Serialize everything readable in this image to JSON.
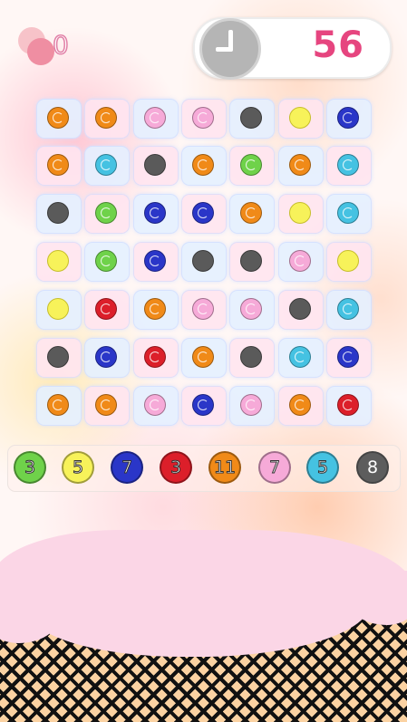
{
  "score": {
    "value": "0"
  },
  "timer": {
    "value": "56",
    "icon": "clock-icon"
  },
  "colors": {
    "orange": "#f08a18",
    "pink": "#f6aad8",
    "black": "#5a5a5a",
    "yellow": "#f7f25a",
    "blue": "#2a36c8",
    "cyan": "#45c2e2",
    "green": "#6fd24a",
    "red": "#dc1f2a"
  },
  "board": [
    [
      "orange",
      "orange",
      "pink",
      "pink",
      "black",
      "yellow",
      "blue"
    ],
    [
      "orange",
      "cyan",
      "black",
      "orange",
      "green",
      "orange",
      "cyan"
    ],
    [
      "black",
      "green",
      "blue",
      "blue",
      "orange",
      "yellow",
      "cyan"
    ],
    [
      "yellow",
      "green",
      "blue",
      "black",
      "black",
      "pink",
      "yellow"
    ],
    [
      "yellow",
      "red",
      "orange",
      "pink",
      "pink",
      "black",
      "cyan"
    ],
    [
      "black",
      "blue",
      "red",
      "orange",
      "black",
      "cyan",
      "blue"
    ],
    [
      "orange",
      "orange",
      "pink",
      "blue",
      "pink",
      "orange",
      "red"
    ]
  ],
  "targets": [
    {
      "color": "green",
      "count": "3"
    },
    {
      "color": "yellow",
      "count": "5"
    },
    {
      "color": "blue",
      "count": "7"
    },
    {
      "color": "red",
      "count": "3"
    },
    {
      "color": "orange",
      "count": "11"
    },
    {
      "color": "pink",
      "count": "7"
    },
    {
      "color": "cyan",
      "count": "5"
    },
    {
      "color": "black",
      "count": "8"
    }
  ]
}
